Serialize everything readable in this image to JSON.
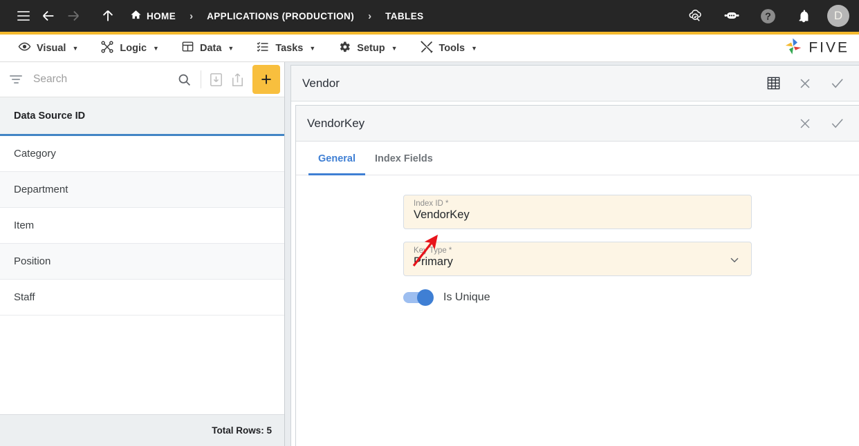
{
  "topbar": {
    "menu_icon": "hamburger-icon",
    "back_icon": "arrow-left-icon",
    "forward_icon": "arrow-right-icon",
    "up_icon": "arrow-up-icon",
    "breadcrumbs": [
      {
        "label": "HOME",
        "icon": "home-icon"
      },
      {
        "label": "APPLICATIONS (PRODUCTION)",
        "icon": ""
      },
      {
        "label": "TABLES",
        "icon": ""
      }
    ],
    "separator": "›",
    "actions": [
      {
        "name": "cloud-check-icon"
      },
      {
        "name": "chatbot-icon"
      },
      {
        "name": "help-icon"
      },
      {
        "name": "bell-icon"
      }
    ],
    "avatar_initial": "D",
    "accent_color": "#f4b92e"
  },
  "menubar": {
    "items": [
      {
        "label": "Visual",
        "icon": "eye-icon"
      },
      {
        "label": "Logic",
        "icon": "graph-nodes-icon"
      },
      {
        "label": "Data",
        "icon": "table-icon"
      },
      {
        "label": "Tasks",
        "icon": "checklist-icon"
      },
      {
        "label": "Setup",
        "icon": "gear-icon"
      },
      {
        "label": "Tools",
        "icon": "tools-icon"
      }
    ],
    "caret": "▼",
    "brand": "FIVE"
  },
  "left_panel": {
    "search": {
      "placeholder": "Search",
      "value": ""
    },
    "toolbar": {
      "filter_icon": "filter-icon",
      "search_icon": "search-icon",
      "import_icon": "import-icon",
      "export_icon": "export-icon",
      "add_label": "+"
    },
    "column_header": "Data Source ID",
    "rows": [
      {
        "name": "Category"
      },
      {
        "name": "Department"
      },
      {
        "name": "Item"
      },
      {
        "name": "Position"
      },
      {
        "name": "Staff"
      }
    ],
    "footer": "Total Rows: 5",
    "header_underline_color": "#4285c5"
  },
  "right_panel": {
    "outer": {
      "title": "Vendor",
      "grid_icon": "table-grid-icon",
      "close_icon": "close-icon",
      "confirm_icon": "check-icon"
    },
    "inner": {
      "title": "VendorKey",
      "close_icon": "close-icon",
      "confirm_icon": "check-icon",
      "tabs": [
        {
          "label": "General",
          "active": true
        },
        {
          "label": "Index Fields",
          "active": false
        }
      ],
      "fields": [
        {
          "label": "Index ID *",
          "value": "VendorKey",
          "type": "text"
        },
        {
          "label": "Key Type *",
          "value": "Primary",
          "type": "select",
          "chevron": "chevron-down-icon"
        }
      ],
      "toggle": {
        "label": "Is Unique",
        "state": "on",
        "color": "#3f7fd4"
      }
    }
  },
  "annotation": {
    "arrow_color": "#e8141b",
    "points_to": "key-type-dropdown-chevron"
  }
}
